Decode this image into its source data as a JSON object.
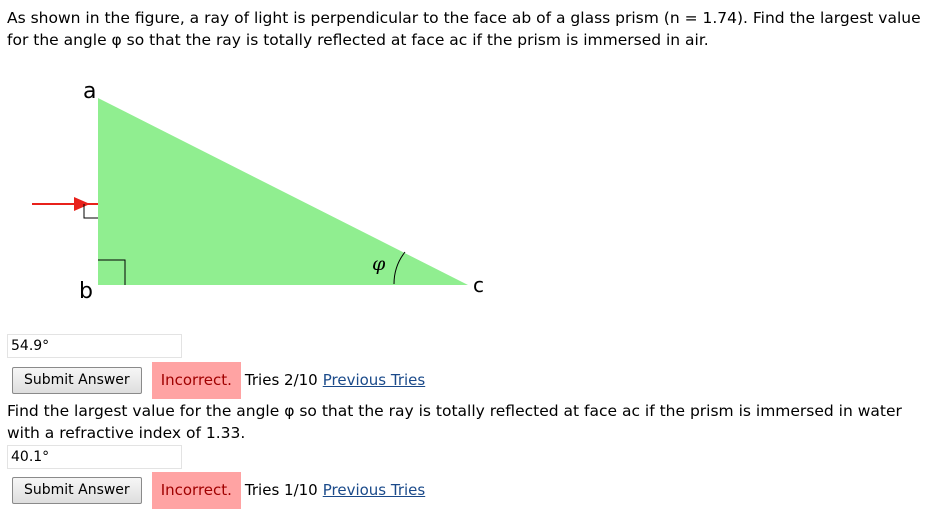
{
  "question1": {
    "text": "As shown in the figure, a ray of light is perpendicular to the face ab of a glass prism (n = 1.74). Find the largest value for the angle φ so that the ray is totally reflected at face ac if the prism is immersed in air.",
    "answer_value": "54.9°",
    "submit_label": "Submit Answer",
    "status": "Incorrect.",
    "tries": "Tries 2/10",
    "previous_tries_label": "Previous Tries"
  },
  "figure": {
    "vertex_a": "a",
    "vertex_b": "b",
    "vertex_c": "c",
    "angle_label": "φ",
    "prism_color": "#90ee90",
    "ray_color": "#e8211b"
  },
  "question2": {
    "text": "Find the largest value for the angle φ so that the ray is totally reflected at face ac if the prism is immersed in water with a refractive index of 1.33.",
    "answer_value": "40.1°",
    "submit_label": "Submit Answer",
    "status": "Incorrect.",
    "tries": "Tries 1/10",
    "previous_tries_label": "Previous Tries"
  },
  "colors": {
    "incorrect_bg": "#ffa3a3",
    "incorrect_text": "#a00000",
    "link": "#1a4a8a"
  }
}
